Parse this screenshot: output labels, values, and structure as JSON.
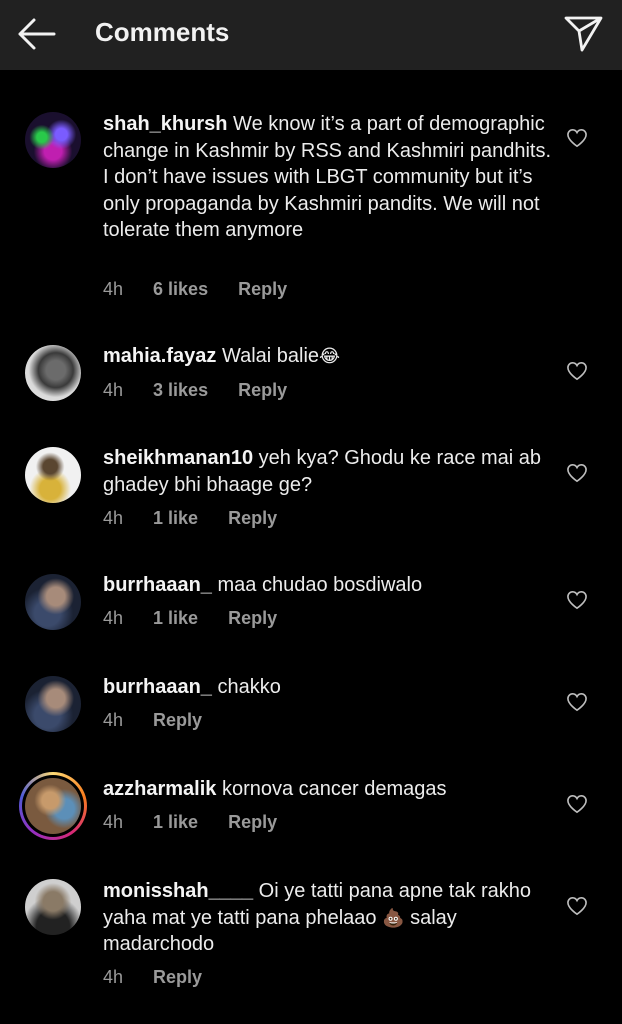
{
  "header": {
    "title": "Comments",
    "back_icon": "arrow-left-icon",
    "share_icon": "paper-plane-icon"
  },
  "comments": [
    {
      "username": "shah_khursh",
      "text": "We know it’s a part of demographic change in Kashmir by RSS and Kashmiri pandhits. I don’t have issues with LBGT community but it’s only propaganda by Kashmiri pandits. We will not tolerate them anymore",
      "time": "4h",
      "likes": "6 likes",
      "reply": "Reply"
    },
    {
      "username": "mahia.fayaz",
      "text": "Walai balie",
      "emoji": "😂",
      "time": "4h",
      "likes": "3 likes",
      "reply": "Reply"
    },
    {
      "username": "sheikhmanan10",
      "text": "yeh kya? Ghodu ke race mai ab ghadey bhi bhaage ge?",
      "time": "4h",
      "likes": "1 like",
      "reply": "Reply"
    },
    {
      "username": "burrhaaan_",
      "text": "maa chudao bosdiwalo",
      "time": "4h",
      "likes": "1 like",
      "reply": "Reply"
    },
    {
      "username": "burrhaaan_",
      "text": "chakko",
      "time": "4h",
      "reply": "Reply"
    },
    {
      "username": "azzharmalik",
      "text": "kornova cancer demagas",
      "time": "4h",
      "likes": "1 like",
      "reply": "Reply"
    },
    {
      "username": "monisshah____",
      "text": "Oi ye tatti pana apne tak rakho yaha mat ye tatti pana phelaao",
      "emoji": "💩",
      "text_after": "salay madarchodo",
      "time": "4h",
      "reply": "Reply"
    }
  ],
  "colors": {
    "background": "#000000",
    "header": "#212121",
    "meta_text": "#9a9a9a",
    "story_ring": "#d62976"
  }
}
